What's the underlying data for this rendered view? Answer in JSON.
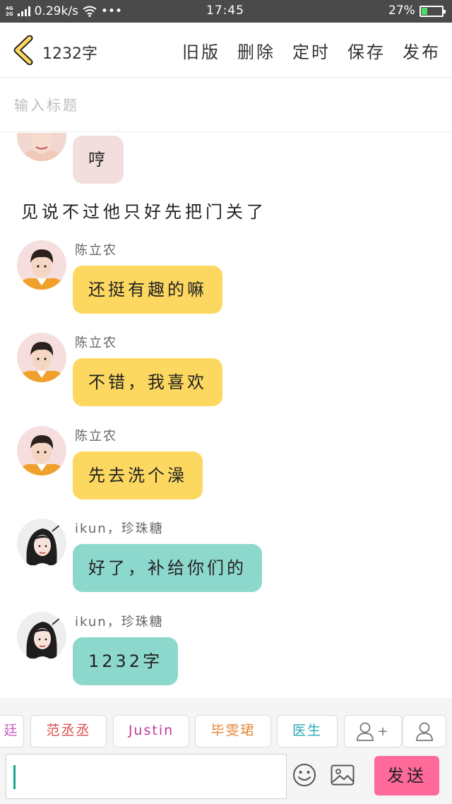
{
  "status_bar": {
    "network": "4G",
    "network2": "2G",
    "speed": "0.29k/s",
    "more": "•••",
    "time": "17:45",
    "battery_pct": "27%",
    "battery_level": 0.27,
    "battery_color": "#4cd964"
  },
  "header": {
    "word_count": "1232字",
    "actions": [
      "旧版",
      "删除",
      "定时",
      "保存",
      "发布"
    ]
  },
  "title_input": {
    "placeholder": "输入标题",
    "value": ""
  },
  "messages": {
    "top_pink": {
      "text": "哼"
    },
    "narration": "见说不过他只好先把门关了",
    "items": [
      {
        "sender": "陈立农",
        "text": "还挺有趣的嘛",
        "color": "#fcd860"
      },
      {
        "sender": "陈立农",
        "text": "不错，我喜欢",
        "color": "#fcd860"
      },
      {
        "sender": "陈立农",
        "text": "先去洗个澡",
        "color": "#fcd860"
      },
      {
        "sender": "ikun，珍珠糖",
        "text": "好了，补给你们的",
        "color": "#8dd8cc"
      },
      {
        "sender": "ikun，珍珠糖",
        "text": "1232字",
        "color": "#8dd8cc"
      }
    ]
  },
  "characters": {
    "partial": "廷",
    "chips": [
      {
        "label": "范丞丞",
        "color": "#e04a4a"
      },
      {
        "label": "Justin",
        "color": "#c0399a"
      },
      {
        "label": "毕雯珺",
        "color": "#e8873a"
      },
      {
        "label": "医生",
        "color": "#2aa9b8"
      }
    ],
    "add_icon": "add-user-icon",
    "add_plus": "+",
    "user_icon": "user-icon"
  },
  "input_bar": {
    "emoji_icon": "emoji-icon",
    "image_icon": "image-icon",
    "send_label": "发送",
    "send_color": "#ff6a9a"
  }
}
